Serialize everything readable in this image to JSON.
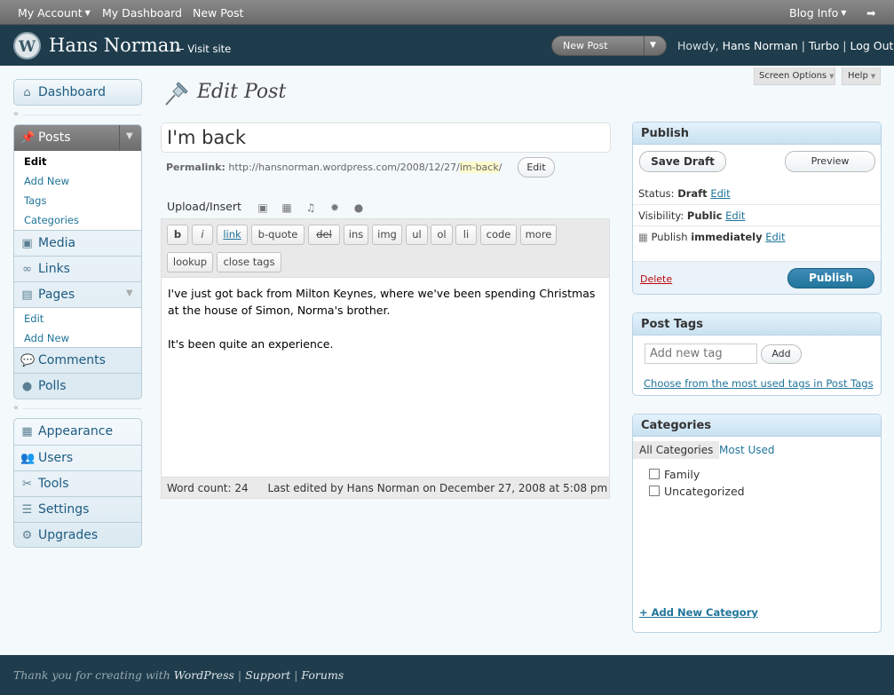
{
  "admin_bar": {
    "my_account": "My Account",
    "my_dashboard": "My Dashboard",
    "new_post": "New Post",
    "blog_info": "Blog Info"
  },
  "header": {
    "site_title": "Hans Norman",
    "visit_site": "← Visit site",
    "new_post_dropdown": "New Post",
    "howdy": "Howdy,",
    "user": "Hans Norman",
    "turbo": "Turbo",
    "logout": "Log Out"
  },
  "screen_options": "Screen Options",
  "help": "Help",
  "menu": {
    "dashboard": "Dashboard",
    "posts": "Posts",
    "posts_sub": [
      "Edit",
      "Add New",
      "Tags",
      "Categories"
    ],
    "media": "Media",
    "links": "Links",
    "pages": "Pages",
    "pages_sub": [
      "Edit",
      "Add New"
    ],
    "comments": "Comments",
    "polls": "Polls",
    "appearance": "Appearance",
    "users": "Users",
    "tools": "Tools",
    "settings": "Settings",
    "upgrades": "Upgrades"
  },
  "edit": {
    "page_title": "Edit Post",
    "post_title": "I'm back",
    "permalink_label": "Permalink:",
    "permalink_base": "http://hansnorman.wordpress.com/2008/12/27/",
    "permalink_slug": "im-back",
    "permalink_end": "/",
    "edit_btn": "Edit",
    "upload_insert": "Upload/Insert",
    "toolbar": [
      "b",
      "i",
      "link",
      "b-quote",
      "del",
      "ins",
      "img",
      "ul",
      "ol",
      "li",
      "code",
      "more",
      "lookup",
      "close tags"
    ],
    "content": [
      "I've just got back from Milton Keynes, where we've been spending Christmas at the house of Simon, Norma's brother.",
      "It's been quite an experience."
    ],
    "word_count": "Word count: 24",
    "last_edited": "Last edited by Hans Norman on December 27, 2008 at 5:08 pm"
  },
  "publish": {
    "title": "Publish",
    "save_draft": "Save Draft",
    "preview": "Preview",
    "status_label": "Status:",
    "status_value": "Draft",
    "visibility_label": "Visibility:",
    "visibility_value": "Public",
    "publish_label": "Publish",
    "publish_value": "immediately",
    "edit": "Edit",
    "delete": "Delete",
    "publish_btn": "Publish"
  },
  "tags": {
    "title": "Post Tags",
    "placeholder": "Add new tag",
    "add": "Add",
    "choose": "Choose from the most used tags in Post Tags"
  },
  "categories": {
    "title": "Categories",
    "tab_all": "All Categories",
    "tab_most": "Most Used",
    "items": [
      "Family",
      "Uncategorized"
    ],
    "add_new": "+ Add New Category"
  },
  "footer": {
    "thanks": "Thank you for creating with",
    "wordpress": "WordPress",
    "support": "Support",
    "forums": "Forums"
  }
}
